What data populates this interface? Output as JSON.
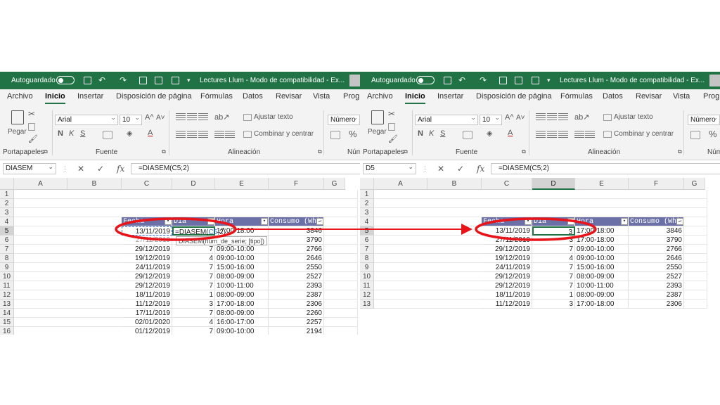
{
  "window": {
    "autosave_label": "Autoguardado",
    "doc_title": "Lectures Llum - Modo de compatibilidad - Ex..."
  },
  "tabs": [
    "Archivo",
    "Inicio",
    "Insertar",
    "Disposición de página",
    "Fórmulas",
    "Datos",
    "Revisar",
    "Vista",
    "Progr"
  ],
  "ribbon": {
    "paste_label": "Pegar",
    "font_name": "Arial",
    "font_size": "10",
    "wrap_label": "Ajustar texto",
    "merge_label": "Combinar y centrar",
    "number_format": "Número",
    "bold": "N",
    "italic": "K",
    "underline": "S",
    "grow_font": "A^",
    "shrink_font": "A˅",
    "font_color_glyph": "A",
    "percent_glyph": "%",
    "groups": {
      "clipboard": "Portapapeles",
      "font": "Fuente",
      "alignment": "Alineación",
      "number_left": "Núm",
      "number_right": "Núm"
    }
  },
  "left": {
    "name_box": "DIASEM",
    "formula": "=DIASEM(C5;2)",
    "editing_formula_prefix": "=DIASEM(",
    "editing_formula_ref": "C5",
    "editing_formula_suffix": ";2)",
    "tooltip": "DIASEM(núm_de_serie; [tipo])",
    "rows_visible": 16
  },
  "right": {
    "name_box": "D5",
    "formula": "=DIASEM(C5;2)",
    "rows_visible": 13
  },
  "columns": [
    "A",
    "B",
    "C",
    "D",
    "E",
    "F",
    "G"
  ],
  "table": {
    "headers": [
      "Fecha",
      "Dia",
      "Hora",
      "Consumo (Wh)"
    ],
    "rows": [
      [
        "13/11/2019",
        "3",
        "17:00-18:00",
        "3846"
      ],
      [
        "27/11/2019",
        "3",
        "17:00-18:00",
        "3790"
      ],
      [
        "29/12/2019",
        "7",
        "09:00-10:00",
        "2766"
      ],
      [
        "19/12/2019",
        "4",
        "09:00-10:00",
        "2646"
      ],
      [
        "24/11/2019",
        "7",
        "15:00-16:00",
        "2550"
      ],
      [
        "29/12/2019",
        "7",
        "08:00-09:00",
        "2527"
      ],
      [
        "29/12/2019",
        "7",
        "10:00-11:00",
        "2393"
      ],
      [
        "18/11/2019",
        "1",
        "08:00-09:00",
        "2387"
      ],
      [
        "11/12/2019",
        "3",
        "17:00-18:00",
        "2306"
      ],
      [
        "17/11/2019",
        "7",
        "08:00-09:00",
        "2260"
      ],
      [
        "02/01/2020",
        "4",
        "16:00-17:00",
        "2257"
      ],
      [
        "01/12/2019",
        "7",
        "09:00-10:00",
        "2194"
      ]
    ]
  },
  "colors": {
    "excel_green": "#217346",
    "table_header": "#6b70a6",
    "annotation": "#e8141a",
    "ref_blue": "#3a6fd8"
  }
}
